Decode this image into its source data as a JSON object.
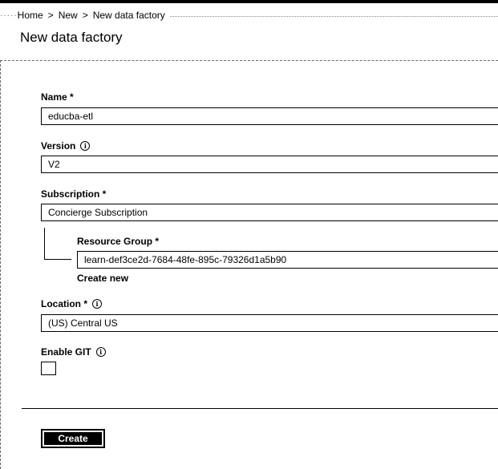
{
  "breadcrumb": {
    "items": [
      {
        "label": "Home"
      },
      {
        "label": "New"
      },
      {
        "label": "New data factory"
      }
    ],
    "separator": ">"
  },
  "page": {
    "title": "New data factory"
  },
  "form": {
    "name": {
      "label": "Name *",
      "value": "educba-etl"
    },
    "version": {
      "label": "Version",
      "value": "V2",
      "info_icon": "info-icon"
    },
    "subscription": {
      "label": "Subscription *",
      "value": "Concierge Subscription"
    },
    "resource_group": {
      "label": "Resource Group *",
      "value": "learn-def3ce2d-7684-48fe-895c-79326d1a5b90",
      "create_new_label": "Create new"
    },
    "location": {
      "label": "Location *",
      "value": "(US) Central US",
      "info_icon": "info-icon"
    },
    "enable_git": {
      "label": "Enable GIT",
      "checked": false,
      "info_icon": "info-icon"
    }
  },
  "actions": {
    "create_label": "Create"
  }
}
